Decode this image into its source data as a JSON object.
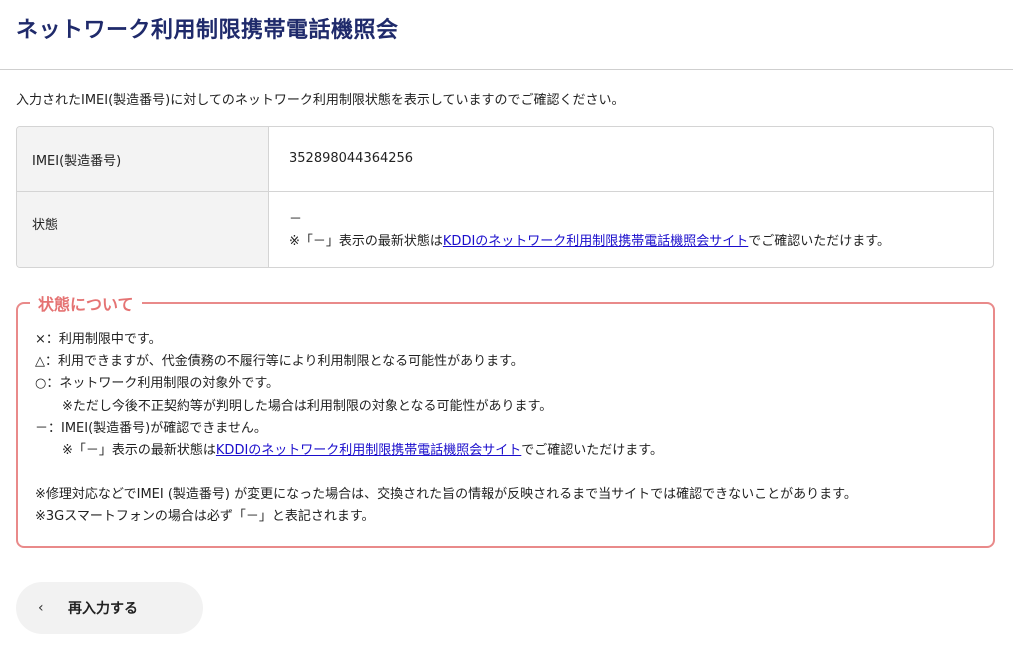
{
  "page_title": "ネットワーク利用制限携帯電話機照会",
  "intro": "入力されたIMEI(製造番号)に対してのネットワーク利用制限状態を表示していますのでご確認ください。",
  "result_table": {
    "imei_label": "IMEI(製造番号)",
    "imei_value": "352898044364256",
    "status_label": "状態",
    "status_value": "－",
    "status_note_prefix": "※「－」表示の最新状態は",
    "status_note_link": "KDDIのネットワーク利用制限携帯電話機照会サイト",
    "status_note_suffix": "でご確認いただけます。"
  },
  "status_box": {
    "title": "状態について",
    "line_x": "×：利用制限中です。",
    "line_triangle": "△：利用できますが、代金債務の不履行等により利用制限となる可能性があります。",
    "line_circle": "○：ネットワーク利用制限の対象外です。",
    "line_circle_note": "※ただし今後不正契約等が判明した場合は利用制限の対象となる可能性があります。",
    "line_dash": "－：IMEI(製造番号)が確認できません。",
    "dash_note_prefix": "※「－」表示の最新状態は",
    "dash_note_link": "KDDIのネットワーク利用制限携帯電話機照会サイト",
    "dash_note_suffix": "でご確認いただけます。",
    "footnote_repair": "※修理対応などでIMEI (製造番号) が変更になった場合は、交換された旨の情報が反映されるまで当サイトでは確認できないことがあります。",
    "footnote_3g": "※3Gスマートフォンの場合は必ず「－」と表記されます。"
  },
  "reenter_button": {
    "icon": "chevron-left-icon",
    "label": "再入力する"
  },
  "colors": {
    "title": "#1f2a6b",
    "status_box_border": "#e98a8a",
    "status_box_title": "#e57373",
    "link": "#1a0dcc"
  }
}
